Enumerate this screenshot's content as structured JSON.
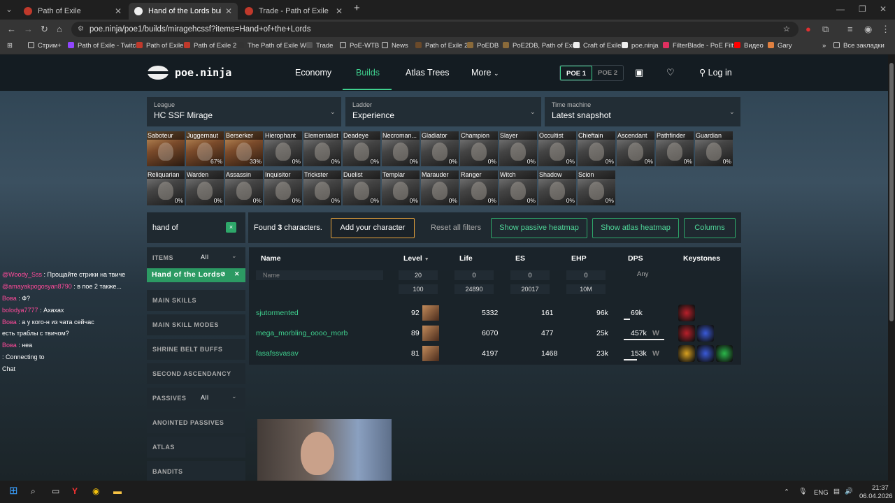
{
  "browser": {
    "tabs": [
      {
        "title": "Path of Exile"
      },
      {
        "title": "Hand of the Lords builds - HC S"
      },
      {
        "title": "Trade - Path of Exile"
      }
    ],
    "new_tab": "+",
    "url": "poe.ninja/poe1/builds/miragehcssf?items=Hand+of+the+Lords",
    "bookmarks": [
      "Стрим+",
      "Path of Exile - Twitch",
      "Path of Exile",
      "Path of Exile 2",
      "The Path of Exile Wiki",
      "Trade",
      "PoE-WTB",
      "News",
      "Path of Exile 2",
      "PoEDB",
      "PoE2DB, Path of Exil...",
      "Craft of Exile",
      "poe.ninja",
      "FilterBlade - PoE Filt...",
      "Видео",
      "Gary"
    ],
    "all_bookmarks": "Все закладки"
  },
  "site": {
    "logo": "poe.ninja",
    "nav": [
      "Economy",
      "Builds",
      "Atlas Trees",
      "More"
    ],
    "poe1": "POE 1",
    "poe2": "POE 2",
    "login": "Log in"
  },
  "selects": [
    {
      "label": "League",
      "value": "HC SSF Mirage"
    },
    {
      "label": "Ladder",
      "value": "Experience"
    },
    {
      "label": "Time machine",
      "value": "Latest snapshot"
    }
  ],
  "classes": [
    {
      "name": "Saboteur",
      "pct": ""
    },
    {
      "name": "Juggernaut",
      "pct": "67%"
    },
    {
      "name": "Berserker",
      "pct": "33%"
    },
    {
      "name": "Hierophant",
      "pct": "0%"
    },
    {
      "name": "Elementalist",
      "pct": "0%"
    },
    {
      "name": "Deadeye",
      "pct": "0%"
    },
    {
      "name": "Necroman...",
      "pct": "0%"
    },
    {
      "name": "Gladiator",
      "pct": "0%"
    },
    {
      "name": "Champion",
      "pct": "0%"
    },
    {
      "name": "Slayer",
      "pct": "0%"
    },
    {
      "name": "Occultist",
      "pct": "0%"
    },
    {
      "name": "Chieftain",
      "pct": "0%"
    },
    {
      "name": "Ascendant",
      "pct": "0%"
    },
    {
      "name": "Pathfinder",
      "pct": "0%"
    },
    {
      "name": "Guardian",
      "pct": "0%"
    },
    {
      "name": "Reliquarian",
      "pct": "0%"
    },
    {
      "name": "Warden",
      "pct": "0%"
    },
    {
      "name": "Assassin",
      "pct": "0%"
    },
    {
      "name": "Inquisitor",
      "pct": "0%"
    },
    {
      "name": "Trickster",
      "pct": "0%"
    },
    {
      "name": "Duelist",
      "pct": "0%"
    },
    {
      "name": "Templar",
      "pct": "0%"
    },
    {
      "name": "Marauder",
      "pct": "0%"
    },
    {
      "name": "Ranger",
      "pct": "0%"
    },
    {
      "name": "Witch",
      "pct": "0%"
    },
    {
      "name": "Shadow",
      "pct": "0%"
    },
    {
      "name": "Scion",
      "pct": "0%"
    }
  ],
  "search": {
    "value": "hand of",
    "clear": "×"
  },
  "toolbar": {
    "found_prefix": "Found ",
    "found_count": "3",
    "found_suffix": " characters.",
    "add_character": "Add your character",
    "reset": "Reset all filters",
    "passive_heatmap": "Show passive heatmap",
    "atlas_heatmap": "Show atlas heatmap",
    "columns": "Columns"
  },
  "sidebar": {
    "items_label": "ITEMS",
    "items_select": "All",
    "item_filter": "Hand of the Lords",
    "sections": [
      "MAIN SKILLS",
      "MAIN SKILL MODES",
      "SHRINE BELT BUFFS",
      "SECOND ASCENDANCY"
    ],
    "passives_label": "PASSIVES",
    "passives_select": "All",
    "sections2": [
      "ANOINTED PASSIVES",
      "ATLAS",
      "BANDITS"
    ]
  },
  "table": {
    "headers": [
      "Name",
      "Level",
      "Life",
      "ES",
      "EHP",
      "DPS",
      "Keystones"
    ],
    "sort_arrow": "▼",
    "name_placeholder": "Name",
    "dps_filter": "Any",
    "filters_min": [
      "20",
      "0",
      "0",
      "0"
    ],
    "filters_max": [
      "100",
      "24890",
      "20017",
      "10M"
    ],
    "rows": [
      {
        "name": "sjutormented",
        "level": "92",
        "life": "5332",
        "es": "161",
        "ehp": "96k",
        "dps": "69k",
        "dps_fill": 0.15,
        "weapon": ""
      },
      {
        "name": "mega_morbling_oooo_morb",
        "level": "89",
        "life": "6070",
        "es": "477",
        "ehp": "25k",
        "dps": "457k",
        "dps_fill": 1.0,
        "weapon": "W"
      },
      {
        "name": "fasafssvasav",
        "level": "81",
        "life": "4197",
        "es": "1468",
        "ehp": "23k",
        "dps": "153k",
        "dps_fill": 0.33,
        "weapon": "W"
      }
    ]
  },
  "chat": [
    {
      "user": "@Woody_Sss",
      "text": " : Прощайте стрики на твиче"
    },
    {
      "user": "@amayakpogosyan8790",
      "text": " : в пое 2 также..."
    },
    {
      "user": "Вова",
      "text": " : Ф?"
    },
    {
      "user": "bolodya7777",
      "text": " : Ахахах"
    },
    {
      "user": "Вова",
      "text": " : а у кого-н из чата сейчас"
    },
    {
      "user": "",
      "text": "есть траблы с твичом?"
    },
    {
      "user": "Вова",
      "text": " : неа"
    },
    {
      "user": "",
      "text": "                              : Connecting to"
    },
    {
      "user": "",
      "text": "Chat"
    }
  ],
  "taskbar": {
    "lang": "ENG",
    "time": "21:37",
    "date": "06.04.2026"
  }
}
